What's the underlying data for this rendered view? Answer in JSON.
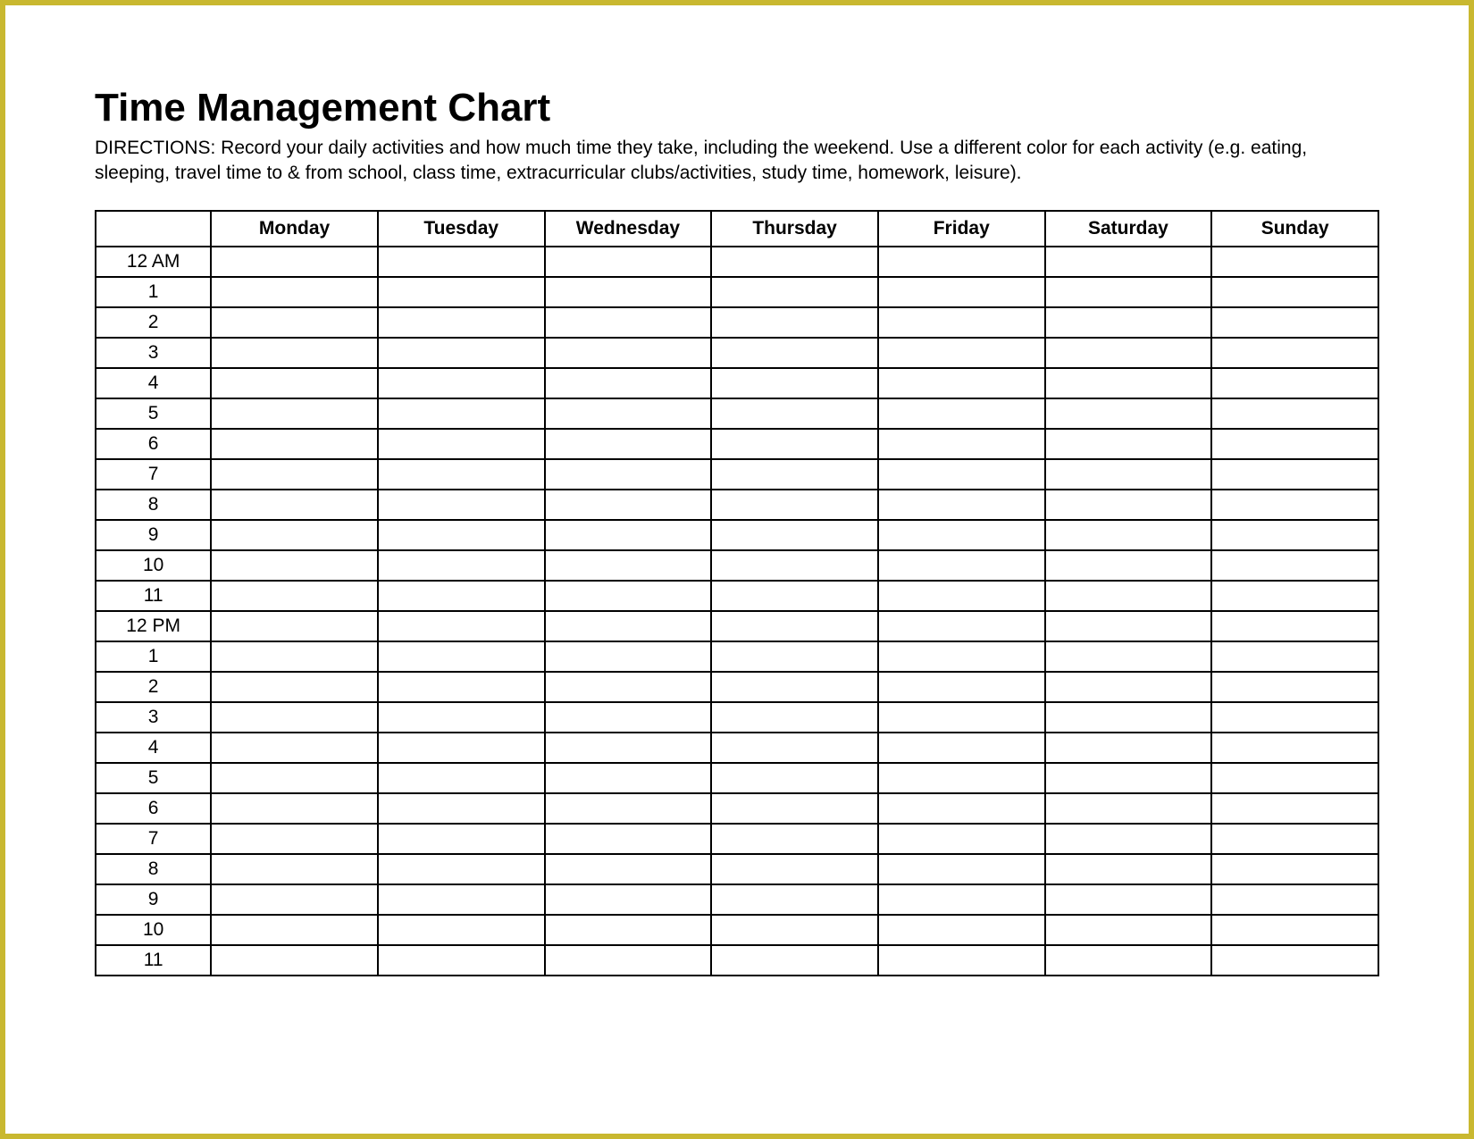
{
  "title": "Time Management Chart",
  "directions": "DIRECTIONS: Record your daily activities and how much time they take, including the weekend. Use a different color for each activity (e.g. eating, sleeping, travel time to & from school, class time, extracurricular clubs/activities, study time, homework, leisure).",
  "days": [
    "Monday",
    "Tuesday",
    "Wednesday",
    "Thursday",
    "Friday",
    "Saturday",
    "Sunday"
  ],
  "hours": [
    "12 AM",
    "1",
    "2",
    "3",
    "4",
    "5",
    "6",
    "7",
    "8",
    "9",
    "10",
    "11",
    "12 PM",
    "1",
    "2",
    "3",
    "4",
    "5",
    "6",
    "7",
    "8",
    "9",
    "10",
    "11"
  ],
  "chart_data": {
    "type": "table",
    "title": "Time Management Chart",
    "columns": [
      "Monday",
      "Tuesday",
      "Wednesday",
      "Thursday",
      "Friday",
      "Saturday",
      "Sunday"
    ],
    "rows": [
      "12 AM",
      "1",
      "2",
      "3",
      "4",
      "5",
      "6",
      "7",
      "8",
      "9",
      "10",
      "11",
      "12 PM",
      "1",
      "2",
      "3",
      "4",
      "5",
      "6",
      "7",
      "8",
      "9",
      "10",
      "11"
    ],
    "cells_empty": true
  }
}
